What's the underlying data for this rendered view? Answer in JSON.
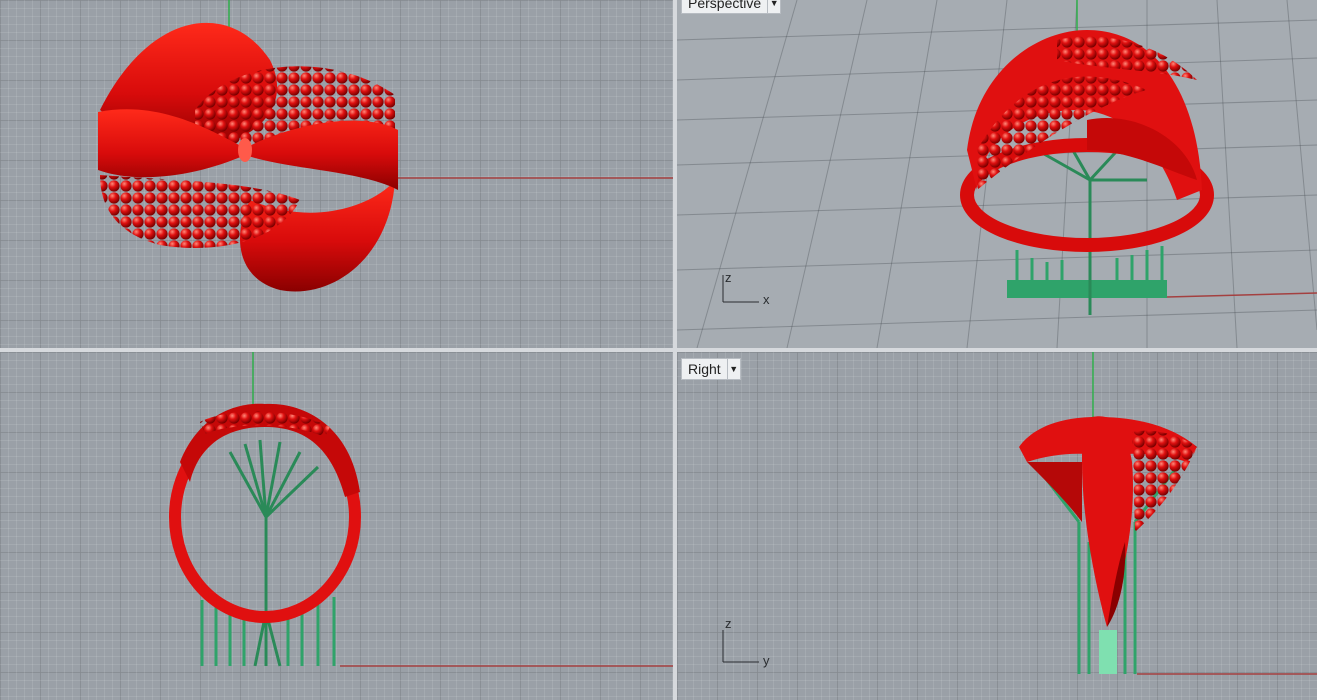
{
  "viewports": {
    "top": {
      "label": ""
    },
    "perspective": {
      "label": "Perspective"
    },
    "front": {
      "label": ""
    },
    "right": {
      "label": "Right"
    }
  },
  "axes": {
    "perspective": {
      "x": "x",
      "z": "z"
    },
    "right": {
      "z": "z",
      "y": "y"
    }
  },
  "colors": {
    "ring": "#e01010",
    "support": "#2fa36a",
    "grid_bg": "#9aa0a7",
    "x_axis": "#a44040",
    "y_axis": "#2fae4a"
  },
  "icons": {
    "dropdown": "chevron-down-icon"
  }
}
